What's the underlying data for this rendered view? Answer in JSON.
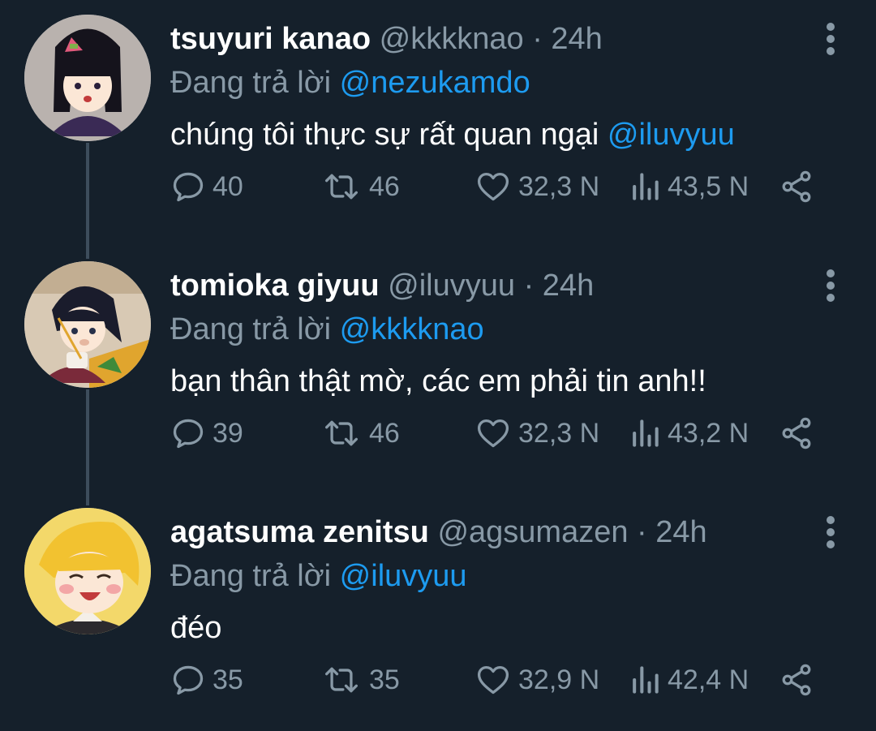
{
  "tweets": [
    {
      "name": "tsuyuri kanao",
      "handle": "@kkkknao",
      "separator": "·",
      "time": "24h",
      "reply_prefix": "Đang trả lời",
      "reply_to": "@nezukamdo",
      "text": "chúng tôi thực sự rất quan ngại ",
      "text_mention": "@iluvyuu",
      "stats": {
        "replies": "40",
        "retweets": "46",
        "likes": "32,3 N",
        "views": "43,5 N"
      },
      "avatar": {
        "bg": "#b9b2ae",
        "hair": "#15131c",
        "accent": "#e15a7c",
        "clothes": "#3a2a55"
      }
    },
    {
      "name": "tomioka giyuu",
      "handle": "@iluvyuu",
      "separator": "·",
      "time": "24h",
      "reply_prefix": "Đang trả lời",
      "reply_to": "@kkkknao",
      "text": "bạn thân thật mờ, các em phải tin anh!!",
      "text_mention": "",
      "stats": {
        "replies": "39",
        "retweets": "46",
        "likes": "32,3 N",
        "views": "43,2 N"
      },
      "avatar": {
        "bg": "#d8c9b4",
        "hair": "#1a1c2c",
        "accent": "#e0a52e",
        "clothes": "#7a2a3a"
      }
    },
    {
      "name": "agatsuma zenitsu",
      "handle": "@agsumazen",
      "separator": "·",
      "time": "24h",
      "reply_prefix": "Đang trả lời",
      "reply_to": "@iluvyuu",
      "text": "đéo",
      "text_mention": "",
      "stats": {
        "replies": "35",
        "retweets": "35",
        "likes": "32,9 N",
        "views": "42,4 N"
      },
      "avatar": {
        "bg": "#f3d86a",
        "hair": "#f2c230",
        "accent": "#f3a6a6",
        "clothes": "#2c2a2e"
      }
    }
  ],
  "icons": {
    "reply": "reply-icon",
    "retweet": "retweet-icon",
    "like": "heart-icon",
    "views": "views-icon",
    "share": "share-icon",
    "more": "more-vertical-icon"
  },
  "colors": {
    "background": "#15202b",
    "text": "#ffffff",
    "muted": "#8899a6",
    "link": "#1d9bf0",
    "thread_line": "#3d4d5c"
  }
}
